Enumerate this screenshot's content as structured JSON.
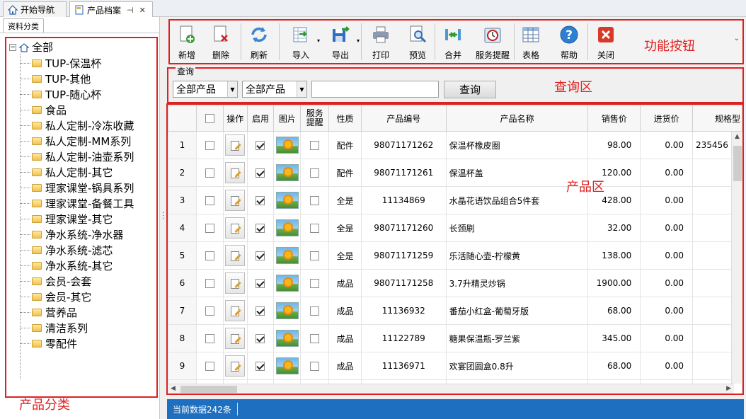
{
  "tabs": [
    {
      "label": "开始导航",
      "icon": "home-icon"
    },
    {
      "label": "产品档案",
      "icon": "document-icon",
      "pin": "ᵖ",
      "close": "✕"
    }
  ],
  "left_panel": {
    "tab_label": "资料分类",
    "root_label": "全部",
    "items": [
      "TUP-保温杯",
      "TUP-其他",
      "TUP-随心杯",
      "食品",
      "私人定制-冷冻收藏",
      "私人定制-MM系列",
      "私人定制-油壶系列",
      "私人定制-其它",
      "理家课堂-锅具系列",
      "理家课堂-备餐工具",
      "理家课堂-其它",
      "净水系统-净水器",
      "净水系统-滤芯",
      "净水系统-其它",
      "会员-会套",
      "会员-其它",
      "营养品",
      "清洁系列",
      "零配件"
    ],
    "annotation": "产品分类"
  },
  "toolbar": {
    "buttons": [
      {
        "label": "新增",
        "icon": "add-document-icon"
      },
      {
        "label": "删除",
        "icon": "delete-document-icon"
      },
      {
        "label": "刷新",
        "icon": "refresh-icon"
      },
      {
        "label": "导入",
        "icon": "import-icon"
      },
      {
        "label": "导出",
        "icon": "export-save-icon"
      },
      {
        "label": "打印",
        "icon": "printer-icon"
      },
      {
        "label": "预览",
        "icon": "preview-icon"
      },
      {
        "label": "合并",
        "icon": "merge-icon"
      },
      {
        "label": "服务提醒",
        "icon": "alarm-clock-icon"
      },
      {
        "label": "表格",
        "icon": "table-icon"
      },
      {
        "label": "帮助",
        "icon": "help-icon"
      },
      {
        "label": "关闭",
        "icon": "close-icon"
      }
    ],
    "annotation": "功能按钮"
  },
  "query": {
    "legend": "查询",
    "select1": "全部产品",
    "select2": "全部产品",
    "input_value": "",
    "button_label": "查询",
    "annotation": "查询区"
  },
  "grid": {
    "columns": [
      "",
      "",
      "操作",
      "启用",
      "图片",
      "服务提醒",
      "性质",
      "产品编号",
      "产品名称",
      "销售价",
      "进货价",
      "规格型"
    ],
    "rows": [
      {
        "no": "1",
        "enabled": true,
        "nature": "配件",
        "code": "98071171262",
        "name": "保温杯橡皮圈",
        "price": "98.00",
        "cost": "0.00",
        "spec": "235456"
      },
      {
        "no": "2",
        "enabled": true,
        "nature": "配件",
        "code": "98071171261",
        "name": "保温杯盖",
        "price": "120.00",
        "cost": "0.00",
        "spec": ""
      },
      {
        "no": "3",
        "enabled": true,
        "nature": "全是",
        "code": "11134869",
        "name": "水晶花语饮品组合5件套",
        "price": "428.00",
        "cost": "0.00",
        "spec": ""
      },
      {
        "no": "4",
        "enabled": true,
        "nature": "全是",
        "code": "98071171260",
        "name": "长颈刷",
        "price": "32.00",
        "cost": "0.00",
        "spec": ""
      },
      {
        "no": "5",
        "enabled": true,
        "nature": "全是",
        "code": "98071171259",
        "name": "乐活随心壶-柠檬黄",
        "price": "138.00",
        "cost": "0.00",
        "spec": ""
      },
      {
        "no": "6",
        "enabled": true,
        "nature": "成品",
        "code": "98071171258",
        "name": "3.7升精灵炒锅",
        "price": "1900.00",
        "cost": "0.00",
        "spec": ""
      },
      {
        "no": "7",
        "enabled": true,
        "nature": "成品",
        "code": "11136932",
        "name": "番茄小红盒-葡萄牙版",
        "price": "68.00",
        "cost": "0.00",
        "spec": ""
      },
      {
        "no": "8",
        "enabled": true,
        "nature": "成品",
        "code": "11122789",
        "name": "糖果保温瓶-罗兰紫",
        "price": "345.00",
        "cost": "0.00",
        "spec": ""
      },
      {
        "no": "9",
        "enabled": true,
        "nature": "成品",
        "code": "11136971",
        "name": "欢宴团圆盒0.8升",
        "price": "68.00",
        "cost": "0.00",
        "spec": ""
      }
    ],
    "annotation": "产品区"
  },
  "status": {
    "text": "当前数据242条"
  },
  "colors": {
    "annotation_red": "#e02020",
    "status_blue": "#1e6fc0"
  }
}
